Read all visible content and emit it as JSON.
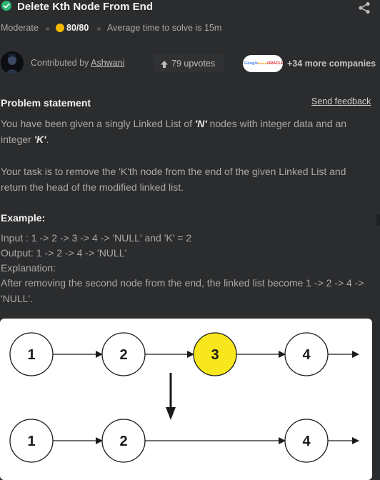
{
  "problem": {
    "title": "Delete Kth Node From End",
    "difficulty": "Moderate",
    "score": "80/80",
    "avg_time": "Average time to solve is 15m"
  },
  "contributor": {
    "prefix": "Contributed by",
    "name": "Ashwani"
  },
  "upvotes": "79 upvotes",
  "companies": {
    "logos": [
      "Google",
      "Amazon",
      "ORACLE"
    ],
    "more": "+34 more companies"
  },
  "statement": {
    "heading": "Problem statement",
    "feedback": "Send feedback",
    "p1_a": "You have been given a singly Linked List of ",
    "p1_n": "'N'",
    "p1_b": " nodes with integer data and an integer ",
    "p1_k": "'K'",
    "p1_c": ".",
    "p2": "Your task is to remove the 'K'th node from the end of the given Linked List and return the head of the modified linked list."
  },
  "example": {
    "heading": "Example:",
    "input": "Input : 1 -> 2 -> 3 -> 4 -> 'NULL'  and  'K' = 2",
    "output": "Output: 1 -> 2 -> 4 -> 'NULL'",
    "explanation_label": "Explanation:",
    "explanation": "After removing the second node from the end, the linked list become 1 -> 2 -> 4 -> 'NULL'."
  },
  "diagram": {
    "before": [
      "1",
      "2",
      "3",
      "4"
    ],
    "after": [
      "1",
      "2",
      "4"
    ],
    "highlight": "3",
    "highlight_color": "#f8e71c"
  },
  "colors": {
    "accent_green": "#2bb673",
    "score_yellow": "#f5b800",
    "background": "#2b2c2e"
  }
}
